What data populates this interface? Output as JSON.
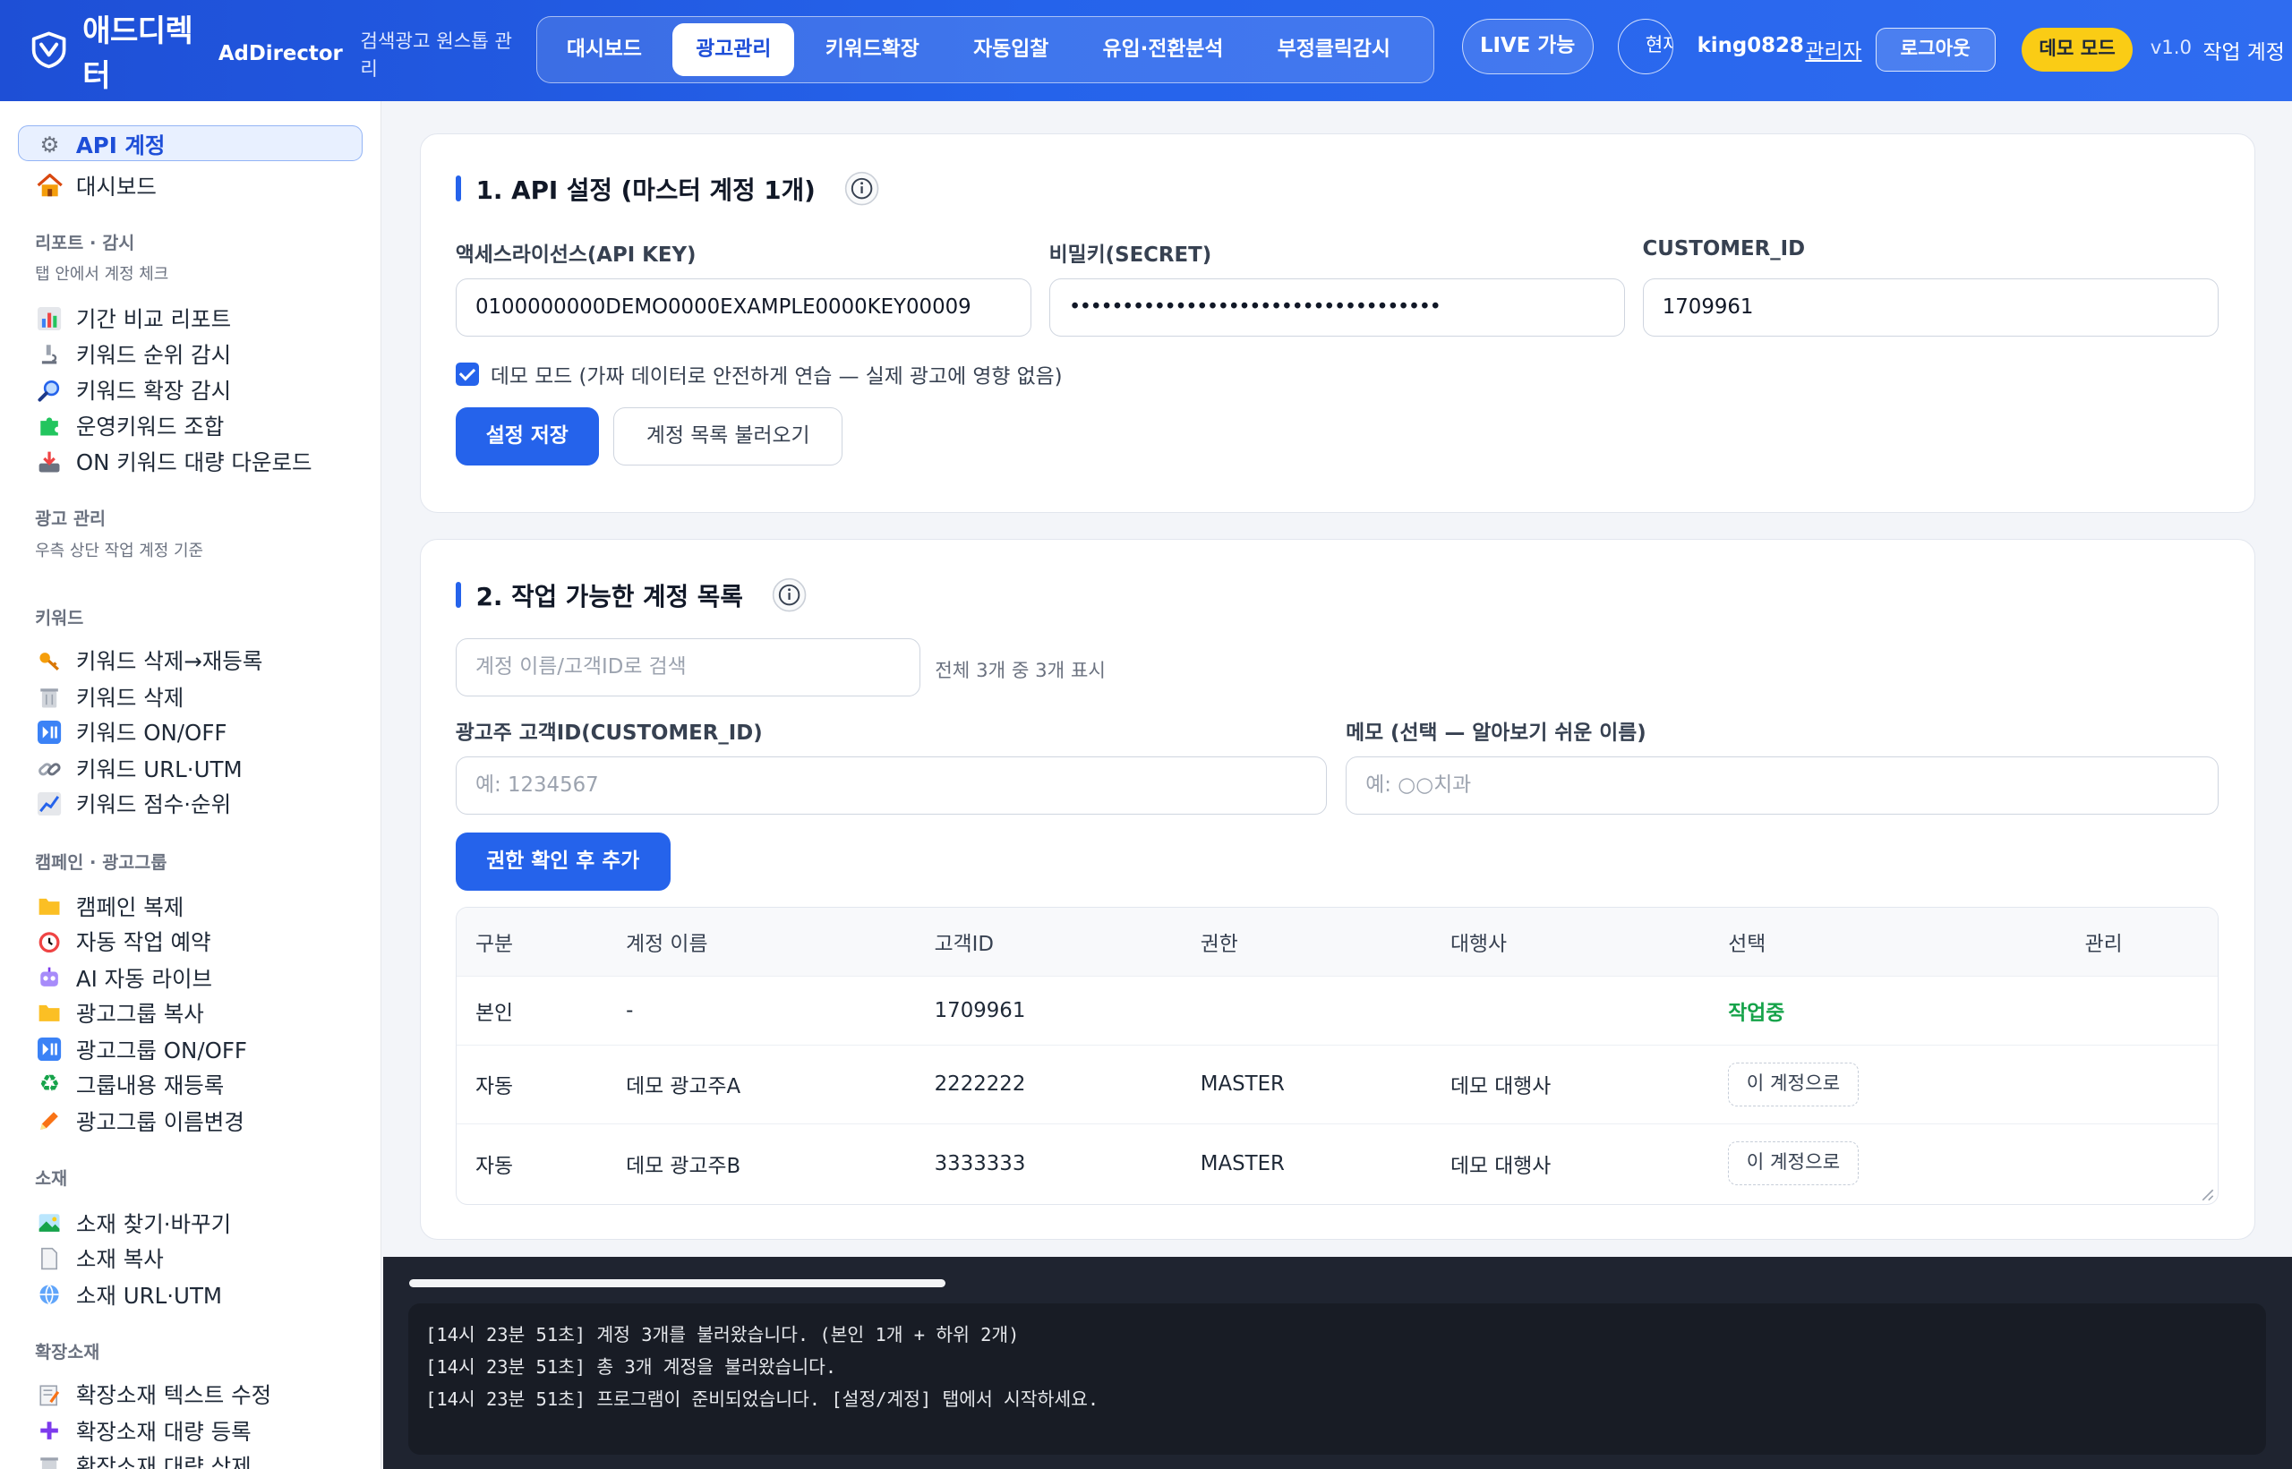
{
  "header": {
    "brand_ko": "애드디렉터",
    "brand_en": "AdDirector",
    "subtitle": "검색광고 원스톱 관리",
    "nav": [
      {
        "label": "대시보드",
        "active": false
      },
      {
        "label": "광고관리",
        "active": true
      },
      {
        "label": "키워드확장",
        "active": false
      },
      {
        "label": "자동입찰",
        "active": false
      },
      {
        "label": "유입·전환분석",
        "active": false
      },
      {
        "label": "부정클릭감시",
        "active": false
      }
    ],
    "live_label": "LIVE 가능",
    "user_circle_text": "현재",
    "username": "king0828",
    "admin_label": "관리자",
    "logout_label": "로그아웃",
    "demo_badge": "데모 모드",
    "version": "v1.0",
    "work_account": "작업 계정"
  },
  "sidebar": {
    "active_item": {
      "icon": "gear-icon",
      "label": "API 계정"
    },
    "dashboard": {
      "icon": "house-icon",
      "label": "대시보드"
    },
    "sections": [
      {
        "title": "리포트 · 감시",
        "hint": "탭 안에서 계정 체크",
        "items": [
          {
            "icon": "bar-chart-icon",
            "label": "기간 비교 리포트"
          },
          {
            "icon": "microscope-icon",
            "label": "키워드 순위 감시"
          },
          {
            "icon": "magnifier-icon",
            "label": "키워드 확장 감시"
          },
          {
            "icon": "puzzle-icon",
            "label": "운영키워드 조합"
          },
          {
            "icon": "download-tray-icon",
            "label": "ON 키워드 대량 다운로드"
          }
        ]
      },
      {
        "title": "광고 관리",
        "hint": "우측 상단 작업 계정 기준",
        "items": []
      },
      {
        "title": "키워드",
        "hint": "",
        "items": [
          {
            "icon": "key-icon",
            "label": "키워드 삭제→재등록"
          },
          {
            "icon": "trash-icon",
            "label": "키워드 삭제"
          },
          {
            "icon": "play-pause-icon",
            "label": "키워드 ON/OFF"
          },
          {
            "icon": "link-icon",
            "label": "키워드 URL·UTM"
          },
          {
            "icon": "trend-chart-icon",
            "label": "키워드 점수·순위"
          }
        ]
      },
      {
        "title": "캠페인 · 광고그룹",
        "hint": "",
        "items": [
          {
            "icon": "folder-icon",
            "label": "캠페인 복제"
          },
          {
            "icon": "alarm-clock-icon",
            "label": "자동 작업 예약"
          },
          {
            "icon": "robot-icon",
            "label": "AI 자동 라이브"
          },
          {
            "icon": "folder-icon",
            "label": "광고그룹 복사"
          },
          {
            "icon": "play-pause-icon",
            "label": "광고그룹 ON/OFF"
          },
          {
            "icon": "recycle-icon",
            "label": "그룹내용 재등록"
          },
          {
            "icon": "pencil-icon",
            "label": "광고그룹 이름변경"
          }
        ]
      },
      {
        "title": "소재",
        "hint": "",
        "items": [
          {
            "icon": "picture-icon",
            "label": "소재 찾기·바꾸기"
          },
          {
            "icon": "page-icon",
            "label": "소재 복사"
          },
          {
            "icon": "globe-icon",
            "label": "소재 URL·UTM"
          }
        ]
      },
      {
        "title": "확장소재",
        "hint": "",
        "items": [
          {
            "icon": "memo-icon",
            "label": "확장소재 텍스트 수정"
          },
          {
            "icon": "plus-icon",
            "label": "확장소재 대량 등록"
          },
          {
            "icon": "trash-icon",
            "label": "확장소재 대량 삭제"
          }
        ]
      }
    ]
  },
  "api_card": {
    "title": "1. API 설정 (마스터 계정 1개)",
    "api_key_label": "액세스라이선스(API KEY)",
    "api_key_value": "0100000000DEMO0000EXAMPLE0000KEY00009",
    "secret_label": "비밀키(SECRET)",
    "secret_value": "•••••••••••••••••••••••••••••••••••",
    "customer_id_label": "CUSTOMER_ID",
    "customer_id_value": "1709961",
    "demo_checked": true,
    "demo_label": "데모 모드 (가짜 데이터로 안전하게 연습 — 실제 광고에 영향 없음)",
    "save_label": "설정 저장",
    "load_label": "계정 목록 불러오기"
  },
  "accounts_card": {
    "title": "2. 작업 가능한 계정 목록",
    "search_placeholder": "계정 이름/고객ID로 검색",
    "count_text": "전체 3개 중 3개 표시",
    "cid_label": "광고주 고객ID(CUSTOMER_ID)",
    "cid_placeholder": "예: 1234567",
    "memo_label": "메모 (선택 — 알아보기 쉬운 이름)",
    "memo_placeholder": "예: ○○치과",
    "add_label": "권한 확인 후 추가",
    "columns": [
      "구분",
      "계정 이름",
      "고객ID",
      "권한",
      "대행사",
      "선택",
      "관리"
    ],
    "rows": [
      {
        "type": "본인",
        "name": "-",
        "cid": "1709961",
        "role": "",
        "agency": "",
        "select": "작업중",
        "is_current": true
      },
      {
        "type": "자동",
        "name": "데모 광고주A",
        "cid": "2222222",
        "role": "MASTER",
        "agency": "데모 대행사",
        "select": "이 계정으로",
        "is_current": false
      },
      {
        "type": "자동",
        "name": "데모 광고주B",
        "cid": "3333333",
        "role": "MASTER",
        "agency": "데모 대행사",
        "select": "이 계정으로",
        "is_current": false
      }
    ]
  },
  "log": {
    "lines": [
      "[14시 23분 51초] 계정 3개를 불러왔습니다. (본인 1개 + 하위 2개)",
      "[14시 23분 51초] 총 3개 계정을 불러왔습니다.",
      "[14시 23분 51초] 프로그램이 준비되었습니다. [설정/계정] 탭에서 시작하세요."
    ]
  },
  "colors": {
    "accent": "#2563eb",
    "header_start": "#1e4fd6",
    "demo_badge": "#facc15",
    "status_working": "#16a34a",
    "console_bg": "#1f2430"
  }
}
